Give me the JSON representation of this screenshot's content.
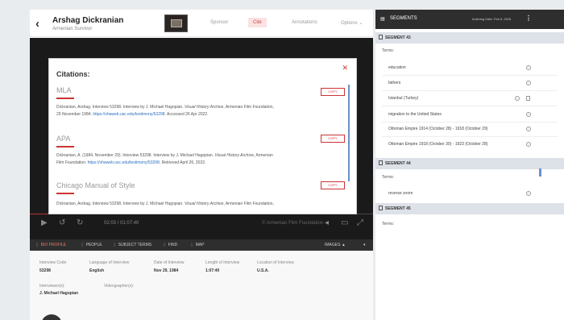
{
  "header": {
    "name": "Arshag Dickranian",
    "subtitle": "Armenian Survivor",
    "nav": [
      "Sponsor",
      "Cite",
      "Annotations",
      "Options"
    ]
  },
  "modal": {
    "title": "Citations:",
    "copy_label": "COPY",
    "styles": [
      {
        "name": "MLA",
        "lines": [
          {
            "plain": "Dickranian, Arshag. Interview 53298. Interview by J. Michael Hagopian. ",
            "italic": "Visual History Archive",
            "plain2": ", Armenian Film Foundation,"
          },
          {
            "plain": "29 November 1984. ",
            "link": "https://vhaweb.usc.edu/testimony/53298",
            "plain2": ". Accessed 26 Apr 2022."
          }
        ]
      },
      {
        "name": "APA",
        "lines": [
          {
            "plain": "Dickranian, A. (1984, November 29). Interview 53298. Interview by J. Michael Hagopian. ",
            "italic": "Visual History Archive",
            "plain2": ", Armenian"
          },
          {
            "plain": "Film Foundation. ",
            "link": "https://vhaweb.usc.edu/testimony/53298",
            "plain2": ". Retrieved April 26, 2022."
          }
        ]
      },
      {
        "name": "Chicago Manual of Style",
        "lines": [
          {
            "plain": "Dickranian, Arshag. Interview 53298. Interview by J. Michael Hagopian. ",
            "italic": "Visual History Archive",
            "plain2": ", Armenian Film Foundation,"
          }
        ]
      }
    ]
  },
  "player": {
    "time": "02:03 / 01:07:40",
    "watermark": "© Armenian Film Foundation"
  },
  "tabs": [
    "BIO PROFILE",
    "PEOPLE",
    "SUBJECT TERMS",
    "FIND",
    "MAP"
  ],
  "images_label": "IMAGES",
  "meta": {
    "labels": [
      "Interview Code",
      "Language of Interview",
      "Date of Interview",
      "Length of Interview",
      "Location of Interview"
    ],
    "values": [
      "53298",
      "English",
      "Nov 29, 1984",
      "1:07:40",
      "U.S.A."
    ],
    "interviewer_label": "Interviewer(s):",
    "interviewer": "J. Michael Hagopian",
    "videographer_label": "Videographer(s):"
  },
  "sidebar": {
    "title": "SEGMENTS",
    "indexing_date": "Indexing Date: Feb 5, 2016",
    "terms_label": "Terms:",
    "segments": [
      {
        "label": "SEGMENT 43",
        "terms": [
          "education",
          "fathers",
          "Istanbul (Turkey)",
          "migration to the United States",
          "Ottoman Empire 1914 (October 28) - 1918 (October 29)",
          "Ottoman Empire 1918 (October 30) - 1923 (October 28)"
        ]
      },
      {
        "label": "SEGMENT 44",
        "terms": [
          "reverse zoom"
        ]
      },
      {
        "label": "SEGMENT 45",
        "terms": []
      }
    ]
  }
}
